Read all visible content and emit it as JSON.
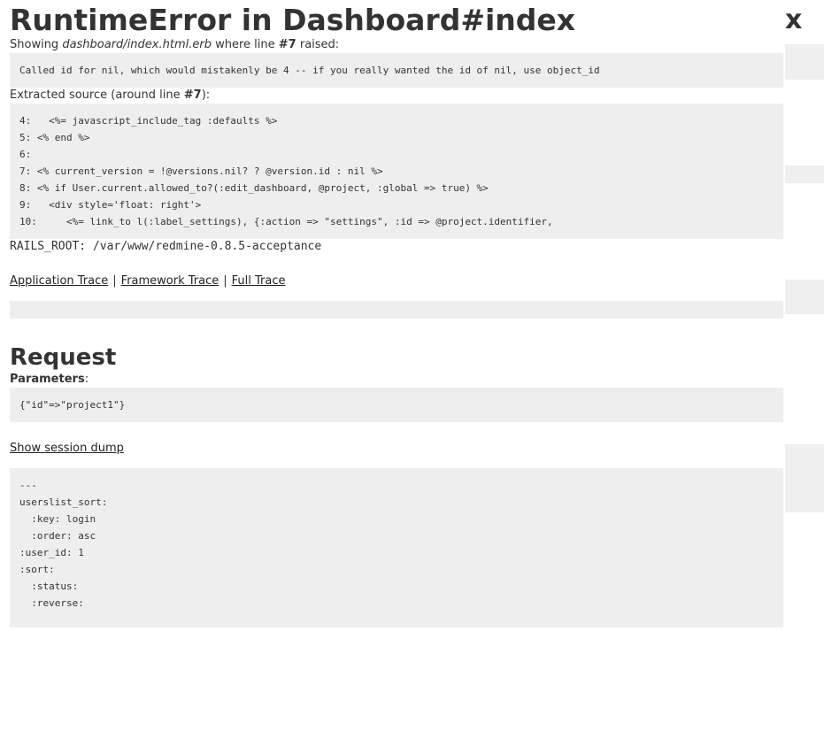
{
  "error": {
    "title": "RuntimeError in Dashboard#index",
    "close_label": "x",
    "showing_prefix": "Showing ",
    "template_path": "dashboard/index.html.erb",
    "showing_middle": " where line ",
    "line_number": "#7",
    "showing_suffix": " raised:",
    "message": "Called id for nil, which would mistakenly be 4 -- if you really wanted the id of nil, use object_id",
    "extracted_prefix": "Extracted source (around line ",
    "extracted_suffix": "):",
    "source_lines": [
      "4:   <%= javascript_include_tag :defaults %>",
      "5: <% end %>",
      "6:",
      "7: <% current_version = !@versions.nil? ? @version.id : nil %>",
      "8: <% if User.current.allowed_to?(:edit_dashboard, @project, :global => true) %>",
      "9:   <div style='float: right'>",
      "10:     <%= link_to l(:label_settings), {:action => \"settings\", :id => @project.identifier,"
    ],
    "rails_root": "RAILS_ROOT: /var/www/redmine-0.8.5-acceptance"
  },
  "trace": {
    "links": [
      "Application Trace",
      "Framework Trace",
      "Full Trace"
    ],
    "separator": "|"
  },
  "request": {
    "heading": "Request",
    "parameters_label": "Parameters",
    "parameters_colon": ":",
    "parameters_value": "{\"id\"=>\"project1\"}",
    "session_link": "Show session dump",
    "session_lines": [
      "---",
      "userslist_sort:",
      "  :key: login",
      "  :order: asc",
      ":user_id: 1",
      ":sort:",
      "  :status:",
      "  :reverse:"
    ]
  }
}
